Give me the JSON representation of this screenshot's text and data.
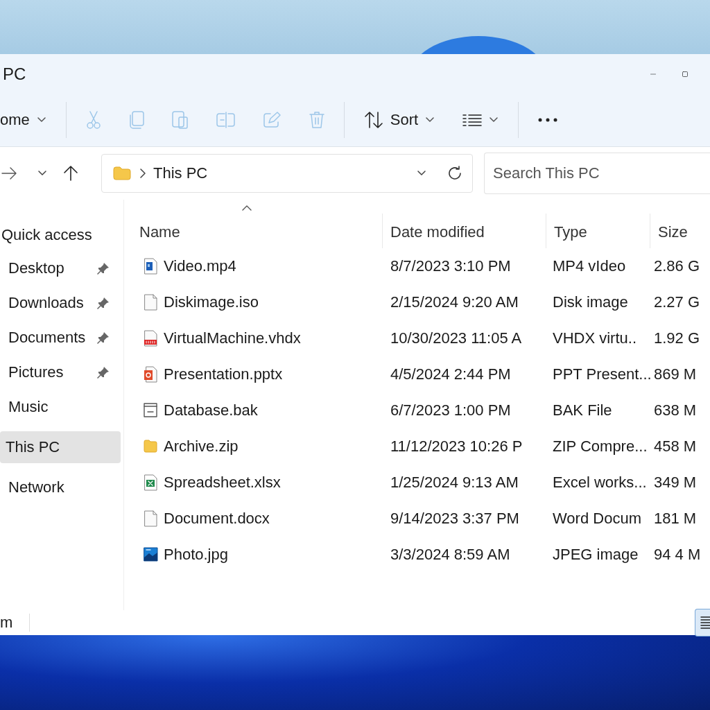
{
  "window": {
    "title": "PC"
  },
  "toolbar": {
    "items": [
      {
        "kind": "menu",
        "label": "ome",
        "disabled": false
      },
      {
        "kind": "divider"
      },
      {
        "kind": "cut",
        "disabled": true
      },
      {
        "kind": "copy",
        "disabled": true
      },
      {
        "kind": "paste",
        "disabled": true
      },
      {
        "kind": "rename",
        "disabled": true
      },
      {
        "kind": "share",
        "disabled": true
      },
      {
        "kind": "delete",
        "disabled": true
      },
      {
        "kind": "divider"
      },
      {
        "kind": "sort",
        "label": "Sort",
        "disabled": false
      },
      {
        "kind": "view",
        "disabled": false
      },
      {
        "kind": "divider"
      },
      {
        "kind": "more",
        "disabled": false
      }
    ]
  },
  "address": {
    "path": [
      "This PC"
    ],
    "search": {
      "placeholder": "Search This PC"
    }
  },
  "sidebar": {
    "header": "Quick access",
    "items": [
      {
        "label": "Desktop",
        "pinned": true,
        "selected": false
      },
      {
        "label": "Downloads",
        "pinned": true,
        "selected": false
      },
      {
        "label": "Documents",
        "pinned": true,
        "selected": false
      },
      {
        "label": "Pictures",
        "pinned": true,
        "selected": false
      },
      {
        "label": "Music",
        "pinned": false,
        "selected": false
      },
      {
        "label": "This PC",
        "pinned": false,
        "selected": true
      },
      {
        "label": "Network",
        "pinned": false,
        "selected": false
      }
    ]
  },
  "table": {
    "columns": [
      "Name",
      "Date modified",
      "Type",
      "Size"
    ],
    "rows": [
      {
        "kind": "video",
        "name": "Video.mp4",
        "date": "8/7/2023 3:10 PM",
        "type": "MP4 vIdeo",
        "size": "2.86 G"
      },
      {
        "kind": "blank",
        "name": "Diskimage.iso",
        "date": "2/15/2024 9:20 AM",
        "type": "Disk image",
        "size": "2.27 G"
      },
      {
        "kind": "disk",
        "name": "VirtualMachine.vhdx",
        "date": "10/30/2023 11:05 A",
        "type": "VHDX virtu..",
        "size": "1.92 G"
      },
      {
        "kind": "slides",
        "name": "Presentation.pptx",
        "date": "4/5/2024 2:44 PM",
        "type": "PPT Present...",
        "size": "869 M"
      },
      {
        "kind": "window",
        "name": "Database.bak",
        "date": "6/7/2023 1:00 PM",
        "type": "BAK File",
        "size": "638 M"
      },
      {
        "kind": "folder",
        "name": "Archive.zip",
        "date": "11/12/2023 10:26 P",
        "type": "ZIP Compre...",
        "size": "458 M"
      },
      {
        "kind": "sheet",
        "name": "Spreadsheet.xlsx",
        "date": "1/25/2024 9:13 AM",
        "type": "Excel works...",
        "size": "349 M"
      },
      {
        "kind": "blank",
        "name": "Document.docx",
        "date": "9/14/2023 3:37 PM",
        "type": "Word Docum",
        "size": "181 M"
      },
      {
        "kind": "image",
        "name": "Photo.jpg",
        "date": "3/3/2024 8:59 AM",
        "type": "JPEG image",
        "size": "94 4 M"
      }
    ]
  },
  "status_bar": {
    "text": "m"
  }
}
